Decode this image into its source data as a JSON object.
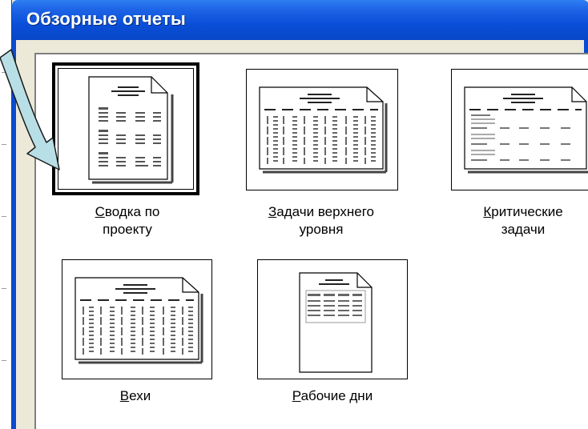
{
  "window": {
    "title": "Обзорные отчеты"
  },
  "reports": [
    {
      "id": "summary",
      "mnemonic": "С",
      "rest1": "водка по",
      "line2": "проекту",
      "selected": true
    },
    {
      "id": "top-level",
      "mnemonic": "З",
      "rest1": "адачи верхнего",
      "line2": "уровня",
      "selected": false
    },
    {
      "id": "critical",
      "mnemonic": "К",
      "rest1": "ритические",
      "line2": "задачи",
      "selected": false
    },
    {
      "id": "milestones",
      "mnemonic": "В",
      "rest1": "ехи",
      "line2": "",
      "selected": false
    },
    {
      "id": "working-days",
      "mnemonic": "Р",
      "rest1": "абочие дни",
      "line2": "",
      "selected": false
    }
  ],
  "icons": {
    "pointer": "curved-arrow-icon",
    "report": "report-page-icon"
  },
  "colors": {
    "titlebar": "#0a4fd8",
    "dialog": "#ece9d8",
    "arrow": "#b8dfe6"
  }
}
